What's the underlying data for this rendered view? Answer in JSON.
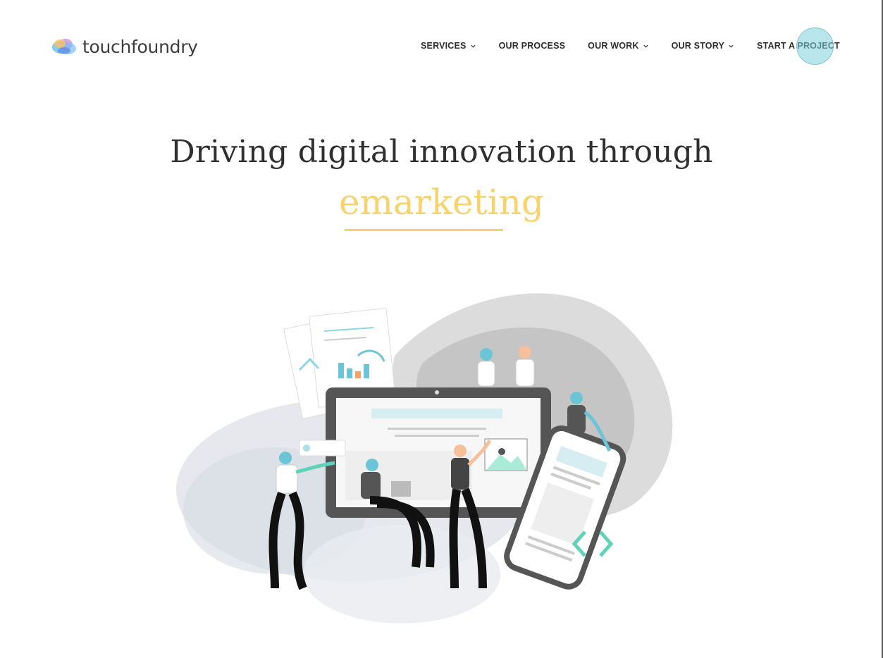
{
  "brand": {
    "name": "touchfoundry"
  },
  "nav": {
    "items": [
      {
        "label": "SERVICES",
        "has_dropdown": true
      },
      {
        "label": "OUR PROCESS",
        "has_dropdown": false
      },
      {
        "label": "OUR WORK",
        "has_dropdown": true
      },
      {
        "label": "OUR STORY",
        "has_dropdown": true
      },
      {
        "label": "START A PROJECT",
        "has_dropdown": false
      }
    ]
  },
  "hero": {
    "headline": "Driving digital innovation through",
    "rotating_word": "emarketing"
  },
  "colors": {
    "accent_yellow": "#f8d36b",
    "accent_teal": "#5fd3b8",
    "accent_blue": "#6cc5d6",
    "text_dark": "#2f2f2f"
  },
  "icons": [
    "chevron-down-icon",
    "touchfoundry-logo-icon"
  ]
}
